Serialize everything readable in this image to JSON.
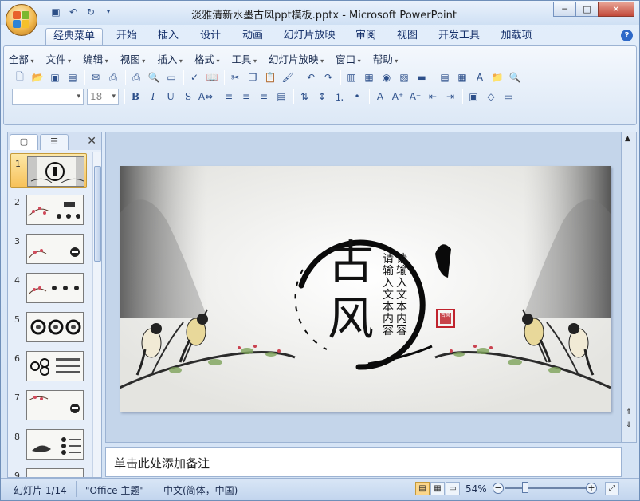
{
  "window": {
    "title": "淡雅清新水墨古风ppt模板.pptx - Microsoft PowerPoint",
    "controls": {
      "minimize": "─",
      "maximize": "□",
      "close": "✕"
    }
  },
  "ribbon_tabs": [
    "经典菜单",
    "开始",
    "插入",
    "设计",
    "动画",
    "幻灯片放映",
    "审阅",
    "视图",
    "开发工具",
    "加载项"
  ],
  "active_tab": "经典菜单",
  "menus": [
    "全部",
    "文件",
    "编辑",
    "视图",
    "插入",
    "格式",
    "工具",
    "幻灯片放映",
    "窗口",
    "帮助"
  ],
  "font_size_value": "18",
  "font_name_value": "",
  "left_panel": {
    "slide_numbers": [
      "1",
      "2",
      "3",
      "4",
      "5",
      "6",
      "7",
      "8",
      "9"
    ]
  },
  "slide": {
    "title_chars": [
      "古",
      "风"
    ],
    "placeholder_cols": [
      "请输入文本内容",
      "请输入文本内容"
    ],
    "seal": "古风"
  },
  "notes_placeholder": "单击此处添加备注",
  "status": {
    "slide_info": "幻灯片 1/14",
    "theme": "\"Office 主题\"",
    "language": "中文(简体，中国)",
    "zoom": "54%",
    "zoom_level": 0.54
  },
  "colors": {
    "ribbon_text": "#15306a",
    "selection": "#f7c158"
  },
  "icons": [
    "office-button-icon",
    "save-icon",
    "undo-icon",
    "redo-icon",
    "help-icon"
  ]
}
